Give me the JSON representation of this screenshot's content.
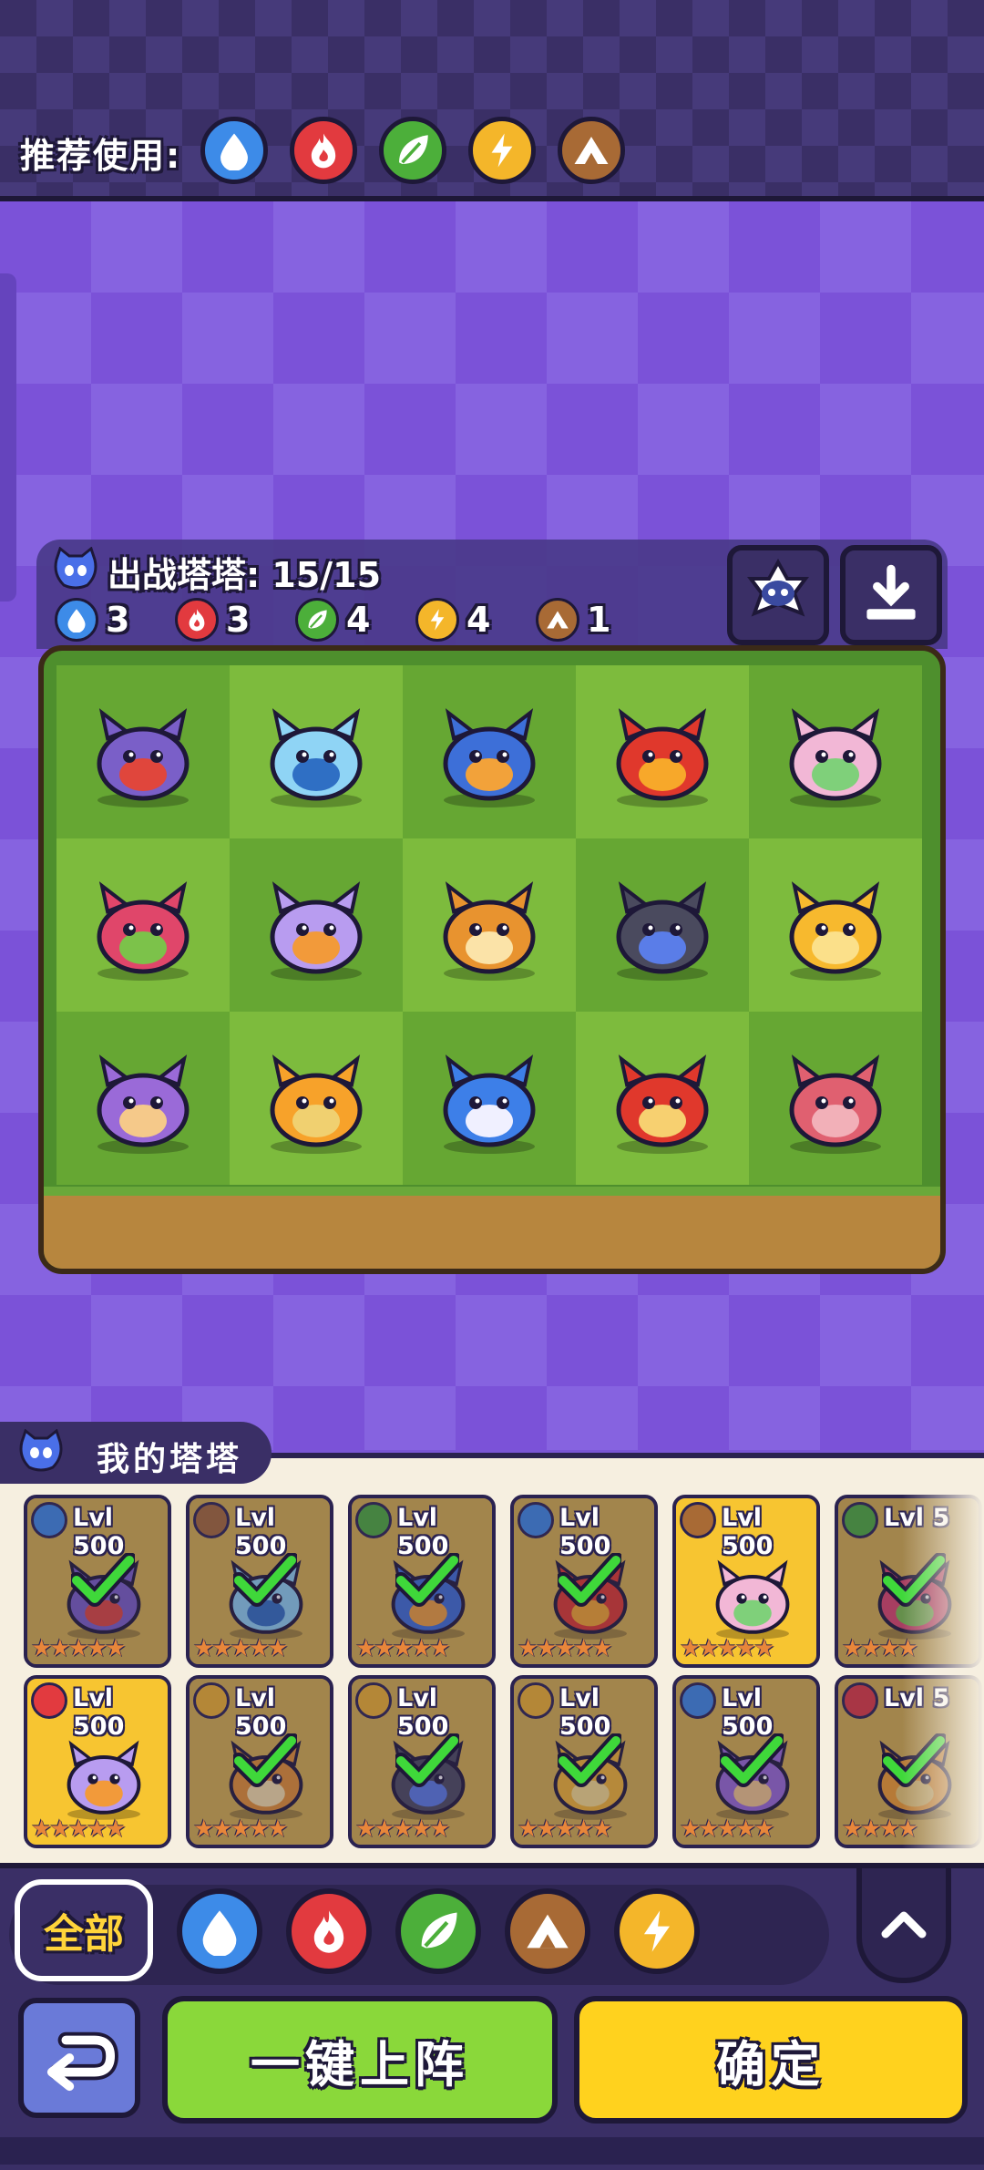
{
  "recommend": {
    "label": "推荐使用:",
    "elements": [
      "water",
      "fire",
      "grass",
      "electric",
      "earth"
    ]
  },
  "element_colors": {
    "water": "#3d8be8",
    "fire": "#e23a3f",
    "grass": "#4caf3a",
    "electric": "#f4b62a",
    "earth": "#a86a35"
  },
  "battle": {
    "title": "出战塔塔: 15/15",
    "counts": [
      {
        "element": "water",
        "value": "3"
      },
      {
        "element": "fire",
        "value": "3"
      },
      {
        "element": "grass",
        "value": "4"
      },
      {
        "element": "electric",
        "value": "4"
      },
      {
        "element": "earth",
        "value": "1"
      }
    ],
    "board": [
      [
        "purple-squirrel",
        "blue-tanuki",
        "blue-bird-creature",
        "red-fire-frog",
        "pink-mantis"
      ],
      [
        "dragonfruit-cat",
        "purple-star-wolf",
        "horned-lion-cub",
        "dark-shark-dino",
        "golden-lion"
      ],
      [
        "mushroom",
        "sunflower",
        "blue-bird",
        "red-fish",
        "pink-pig-bowl"
      ]
    ]
  },
  "roster": {
    "title": "我的塔塔",
    "cards": [
      {
        "element": "water",
        "level": "Lvl 500",
        "selected": true,
        "highlight": false,
        "stars": "★★★★★"
      },
      {
        "element": "earth",
        "level": "Lvl 500",
        "selected": true,
        "highlight": false,
        "stars": "★★★★★"
      },
      {
        "element": "grass",
        "level": "Lvl 500",
        "selected": true,
        "highlight": false,
        "stars": "★★★★★"
      },
      {
        "element": "water",
        "level": "Lvl 500",
        "selected": true,
        "highlight": false,
        "stars": "★★★★★"
      },
      {
        "element": "earth",
        "level": "Lvl 500",
        "selected": false,
        "highlight": true,
        "stars": "★★★★★"
      },
      {
        "element": "grass",
        "level": "Lvl 5",
        "selected": true,
        "highlight": false,
        "stars": "★★★★"
      },
      {
        "element": "fire",
        "level": "Lvl 500",
        "selected": false,
        "highlight": true,
        "stars": "★★★★★"
      },
      {
        "element": "electric",
        "level": "Lvl 500",
        "selected": true,
        "highlight": false,
        "stars": "★★★★★"
      },
      {
        "element": "electric",
        "level": "Lvl 500",
        "selected": true,
        "highlight": false,
        "stars": "★★★★★"
      },
      {
        "element": "electric",
        "level": "Lvl 500",
        "selected": true,
        "highlight": false,
        "stars": "★★★★★"
      },
      {
        "element": "water",
        "level": "Lvl 500",
        "selected": true,
        "highlight": false,
        "stars": "★★★★★"
      },
      {
        "element": "fire",
        "level": "Lvl 5",
        "selected": true,
        "highlight": false,
        "stars": "★★★★"
      }
    ]
  },
  "filters": {
    "all_label": "全部",
    "elements": [
      "water",
      "fire",
      "grass",
      "earth",
      "electric"
    ]
  },
  "actions": {
    "deploy_label": "一键上阵",
    "confirm_label": "确定"
  }
}
